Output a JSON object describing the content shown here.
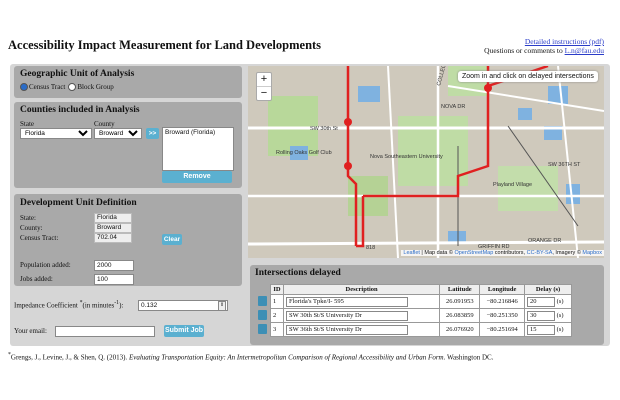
{
  "header": {
    "title": "Accessibility Impact Measurement for Land Developments",
    "instructions_link": "Detailed instructions (pdf)",
    "contact_prefix": "Questions or comments to ",
    "contact_email": "L.n@fau.edu"
  },
  "geo_unit": {
    "heading": "Geographic Unit of Analysis",
    "options": [
      "Census Tract",
      "Block Group"
    ],
    "selected": "Census Tract"
  },
  "counties": {
    "heading": "Counties included in Analysis",
    "state_label": "State",
    "county_label": "County",
    "state_value": "Florida",
    "county_value": "Broward",
    "add_label": ">>",
    "selected_list": [
      "Broward (Florida)"
    ],
    "remove_label": "Remove"
  },
  "development": {
    "heading": "Development Unit Definition",
    "state_label": "State:",
    "state_value": "Florida",
    "county_label": "County:",
    "county_value": "Broward",
    "tract_label": "Census Tract:",
    "tract_value": "702.04",
    "clear_label": "Clear",
    "population_label": "Population added:",
    "population_value": "2000",
    "jobs_label": "Jobs added:",
    "jobs_value": "100"
  },
  "impedance": {
    "label_pre": "Impedance Coefficient ",
    "label_mid": "(in minutes",
    "label_post": "):",
    "value": "0.132"
  },
  "email": {
    "label": "Your email:",
    "value": "",
    "submit_label": "Submit Job"
  },
  "map": {
    "tooltip": "Zoom in and click on delayed intersections",
    "zoom_in": "+",
    "zoom_out": "−",
    "attr_leaflet": "Leaflet",
    "attr_mid1": " | Map data © ",
    "attr_osm": "OpenStreetMap",
    "attr_mid2": " contributors, ",
    "attr_cc": "CC-BY-SA",
    "attr_mid3": ", Imagery © ",
    "attr_mapbox": "Mapbox",
    "labels": {
      "sw36": "SW 36TH ST",
      "sw30": "SW 30th St",
      "nova": "NOVA DR",
      "college": "COLLEGE A",
      "univ": "Nova Southeastern University",
      "rolling": "Rolling Oaks Golf Club",
      "playland": "Playland Village",
      "orange": "ORANGE DR",
      "griffin": "GRIFFIN RD",
      "rt818": "818"
    },
    "colors": {
      "route": "#e02020",
      "water": "#7fb2e0",
      "park": "#b8d89a"
    }
  },
  "intersections": {
    "heading": "Intersections delayed",
    "columns": [
      "ID",
      "Description",
      "Latitude",
      "Longitude",
      "Delay (s)"
    ],
    "rows": [
      {
        "id": "1",
        "description": "Florida's Tpke/I- 595",
        "lat": "26.091953",
        "lon": "−80.216846",
        "delay": "20",
        "unit": "(s)"
      },
      {
        "id": "2",
        "description": "SW 30th St/S University Dr",
        "lat": "26.083859",
        "lon": "−80.251350",
        "delay": "30",
        "unit": "(s)"
      },
      {
        "id": "3",
        "description": "SW 36th St/S University Dr",
        "lat": "26.076920",
        "lon": "−80.251694",
        "delay": "15",
        "unit": "(s)"
      }
    ]
  },
  "footnote": {
    "text_pre": "Grengs, J., Levine, J., & Shen, Q. (2013). ",
    "text_italic": "Evaluating Transportation Equity: An Intermetropolitan Comparison of Regional Accessibility and Urban Form.",
    "text_post": " Washington DC."
  }
}
